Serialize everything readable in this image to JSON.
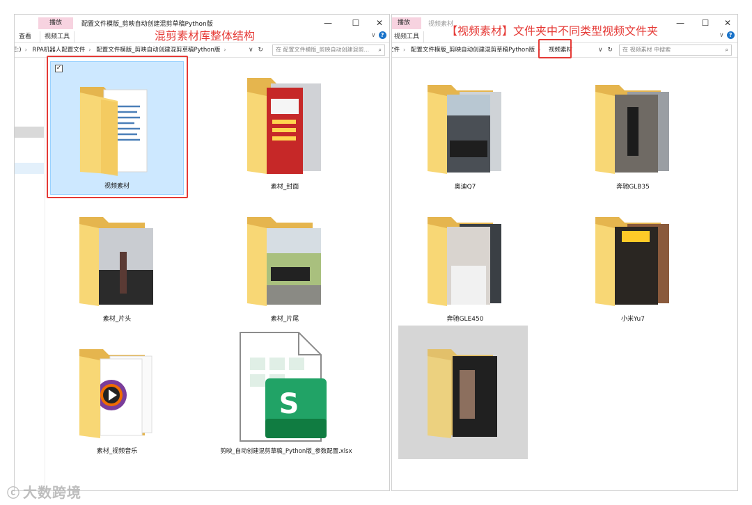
{
  "left_window": {
    "context_tab": "播放",
    "title": "配置文件模版_剪映自动创建混剪草稿Python版",
    "ribbon_tabs": [
      "查看",
      "视频工具"
    ],
    "breadcrumb": [
      "E:)",
      "RPA机器人配置文件",
      "配置文件模版_剪映自动创建混剪草稿Python版"
    ],
    "search_placeholder": "在 配置文件模版_剪映自动创建混剪...",
    "annotation": "混剪素材库整体结构",
    "items": [
      {
        "label": "视频素材",
        "kind": "folder-docs",
        "selected": true
      },
      {
        "label": "素材_封面",
        "kind": "folder-photo"
      },
      {
        "label": "素材_片头",
        "kind": "folder-photo"
      },
      {
        "label": "素材_片尾",
        "kind": "folder-photo"
      },
      {
        "label": "素材_视频音乐",
        "kind": "folder-media"
      },
      {
        "label": "剪映_自动创建混剪草稿_Python版_参数配置.xlsx",
        "kind": "xlsx"
      }
    ]
  },
  "right_window": {
    "context_tab": "播放",
    "title": "视频素材",
    "ribbon_tabs": [
      "视频工具"
    ],
    "breadcrumb": [
      "文件",
      "配置文件模版_剪映自动创建混剪草稿Python版",
      "视频素材"
    ],
    "search_placeholder": "在 视频素材 中搜索",
    "annotation": "【视频素材】文件夹中不同类型视频文件夹",
    "items": [
      {
        "label": "奥迪Q7",
        "kind": "folder-photo"
      },
      {
        "label": "奔驰GLB35",
        "kind": "folder-photo"
      },
      {
        "label": "奔驰GLE450",
        "kind": "folder-photo"
      },
      {
        "label": "小米Yu7",
        "kind": "folder-photo"
      },
      {
        "label": "",
        "kind": "folder-blurred"
      }
    ]
  },
  "window_buttons": {
    "minimize": "—",
    "maximize": "☐",
    "close": "✕"
  },
  "xlsx_icon_letter": "S",
  "watermark": "大数跨境",
  "icons": [
    "folder-icon",
    "checkbox-icon",
    "refresh-icon",
    "search-icon",
    "help-icon",
    "chevron-down-icon",
    "xlsx-icon"
  ],
  "colors": {
    "annotation_red": "#e53935",
    "selection": "#cde8ff",
    "folder": "#f6cf6b",
    "xlsx_green": "#21a366"
  }
}
